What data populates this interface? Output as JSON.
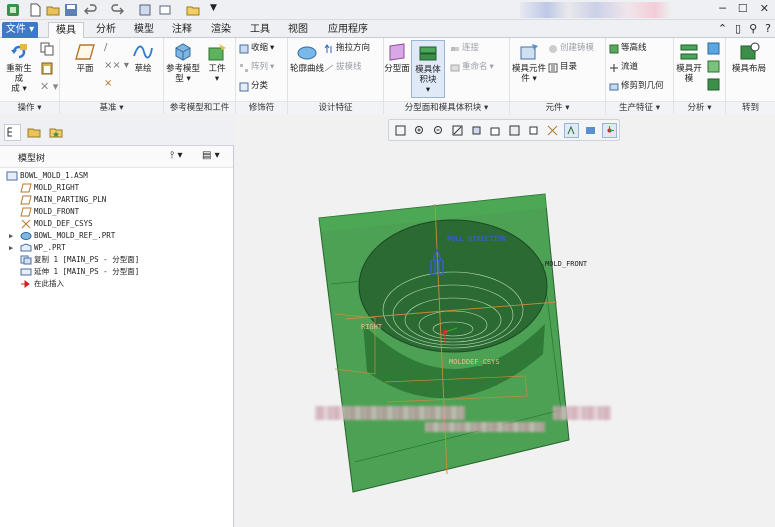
{
  "tabs": [
    {
      "label": "文件"
    },
    {
      "label": "模具"
    },
    {
      "label": "分析"
    },
    {
      "label": "模型"
    },
    {
      "label": "注释"
    },
    {
      "label": "渲染"
    },
    {
      "label": "工具"
    },
    {
      "label": "视图"
    },
    {
      "label": "应用程序"
    }
  ],
  "ribbon": {
    "groups": [
      {
        "label": "操作"
      },
      {
        "label": "基准"
      },
      {
        "label": "参考模型和工件"
      },
      {
        "label": "修饰符"
      },
      {
        "label": "设计特征"
      },
      {
        "label": "分型面和模具体积块"
      },
      {
        "label": "元件"
      },
      {
        "label": "生产特征"
      },
      {
        "label": "分析"
      },
      {
        "label": "转到"
      }
    ],
    "regenerate": "重新生成",
    "plane": "平面",
    "sketch": "草绘",
    "ref_model": "参考模型",
    "workpiece": "工件",
    "shrink": "收缩",
    "pattern": "阵列",
    "classify": "分类",
    "draft_dir": "拖拉方向",
    "draft_line": "拔模线",
    "contour_curve": "轮廓曲线",
    "parting_surface": "分型面",
    "mold_volume": "模具体积块",
    "connect": "连接",
    "rename": "重命名",
    "mold_component": "模具元件",
    "create_cast": "创建铸模",
    "catalog": "目录",
    "contour_line": "等高线",
    "runner": "流道",
    "trim_to_geom": "修剪到几何",
    "mold_open": "模具开模",
    "mold_layout": "模具布局"
  },
  "model_tree": {
    "title": "模型树",
    "items": [
      {
        "label": "BOWL_MOLD_1.ASM"
      },
      {
        "label": "MOLD_RIGHT"
      },
      {
        "label": "MAIN_PARTING_PLN"
      },
      {
        "label": "MOLD_FRONT"
      },
      {
        "label": "MOLD_DEF_CSYS"
      },
      {
        "label": "BOWL_MOLD_REF_.PRT"
      },
      {
        "label": "WP_.PRT"
      },
      {
        "label": "复制 1 [MAIN_PS - 分型面]"
      },
      {
        "label": "延伸 1 [MAIN_PS - 分型面]"
      },
      {
        "label": "在此插入"
      }
    ]
  },
  "viewport": {
    "pull_direction": "PULL DIRECTION",
    "mold_front": "MOLD_FRONT",
    "mold_def_csys": "MOLDDEF_CSYS",
    "right_label": "RIGHT",
    "colors": {
      "body": "#3f9a46",
      "cavity": "#2b6b33",
      "pull_arrow": "#3560d8",
      "datum": "#c98a3a"
    }
  }
}
